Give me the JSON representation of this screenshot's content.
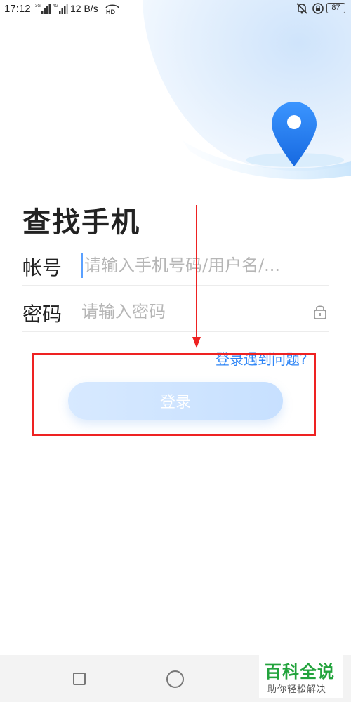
{
  "status_bar": {
    "time": "17:12",
    "signal_1_label": "3G",
    "signal_2_label": "4G",
    "net_speed": "12 B/s",
    "hd_label": "HD",
    "battery": "87"
  },
  "main": {
    "title": "查找手机",
    "account_label": "帐号",
    "account_placeholder": "请输入手机号码/用户名/...",
    "password_label": "密码",
    "password_placeholder": "请输入密码",
    "trouble_link": "登录遇到问题?",
    "login_button": "登录"
  },
  "watermark": {
    "main": "百科全说",
    "sub": "助你轻松解决"
  },
  "colors": {
    "link": "#2f86f6",
    "annotation": "#ee2222",
    "watermark": "#22a33c"
  }
}
